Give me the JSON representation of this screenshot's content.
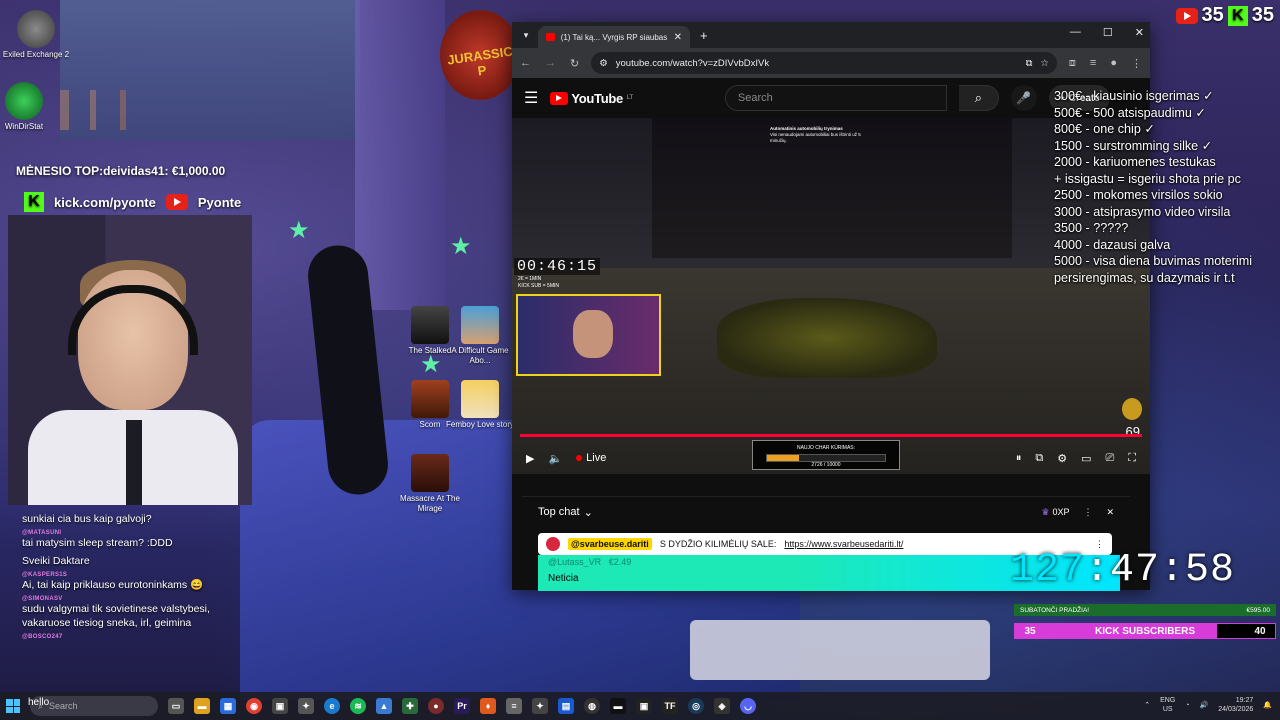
{
  "top_counters": {
    "youtube": "35",
    "kick": "35"
  },
  "overlay": {
    "top_donor": "MĖNESIO TOP:deividas41: €1,000.00",
    "kick_link": "kick.com/pyonte",
    "youtube_name": "Pyonte"
  },
  "desktop_icons": [
    {
      "label": "Exiled Exchange 2"
    },
    {
      "label": "WinDirStat"
    },
    {
      "label": "The Stalked"
    },
    {
      "label": "A Difficult Game Abo..."
    },
    {
      "label": "Scorn"
    },
    {
      "label": "Femboy Love story"
    },
    {
      "label": "Massacre At The Mirage"
    }
  ],
  "poster_text": "JURASSIC P",
  "stream_chat": [
    {
      "user": "",
      "text": "sunkiai cia bus kaip galvoji?"
    },
    {
      "user": "@MATASUNI",
      "text": "tai matysim sleep stream? :DDD"
    },
    {
      "user": "",
      "text": "Sveiki Daktare"
    },
    {
      "user": "@KASPERS1S",
      "text": "Ai, tai kaip priklauso eurotoninkams 😄"
    },
    {
      "user": "@SIMONASV",
      "text": "sudu valgymai tik sovietinese valstybesi, vakaruose tiesiog sneka, irl, geimina"
    },
    {
      "user": "@BOSCO247",
      "text": ""
    }
  ],
  "browser": {
    "tab_title": "(1) Tai ką... Vyrgis RP siaubas. B...",
    "url": "youtube.com/watch?v=zDIVvbDxIVk",
    "youtube": {
      "logo": "YouTube",
      "region": "LT",
      "search_placeholder": "Search",
      "create_label": "Create"
    },
    "video": {
      "timer": "00:46:15",
      "timer_sub": "2€ = 1MIN\nKICK SUB = 5MIN",
      "notification_title": "Automatinis automobilių trynimas",
      "notification_text": "Visi nenaudojami automobiliai bus ištrinti už 5 minučių.",
      "viewer_number": "69",
      "live_label": "Live",
      "goal_title": "NAUJO CHAR KŪRIMAS:",
      "goal_value": "2726 / 10000",
      "goal_progress": 0.27
    },
    "chat": {
      "header": "Top chat",
      "xp": "0XP",
      "pinned_user": "@svarbeuse.dariti",
      "pinned_text": "S DYDŽIO KILIMĖLIŲ SALE:",
      "pinned_link": "https://www.svarbeusedariti.lt/",
      "superchat_user": "@Lutass_VR",
      "superchat_amount": "€2.49",
      "superchat_text": "Neticia"
    }
  },
  "donation_list": [
    "300€ - kiausinio isgerimas ✓",
    "500€ - 500 atsispaudimu ✓",
    "800€ - one chip ✓",
    "1500 - surstromming silke ✓",
    "2000 - kariuomenes testukas",
    "+ issigastu = isgeriu shota prie pc",
    "2500 - mokomes virsilos sokio",
    "3000 - atsiprasymo video virsila",
    "3500 - ?????",
    "4000 - dazausi galva",
    "5000 - visa diena buvimas moterimi",
    "persirengimas, su dazymais ir t.t"
  ],
  "big_clock": {
    "hours": "127",
    "rest": ":47:58"
  },
  "sub_goal": {
    "label": "SUBATONČI PRADŽIA!",
    "value": "€595.00"
  },
  "kick_subs": {
    "left": "35",
    "label": "KICK SUBSCRIBERS",
    "right": "40"
  },
  "taskbar": {
    "search_placeholder": "Search",
    "hello": "hello",
    "lang_top": "ENG",
    "lang_bottom": "US",
    "time": "19:27",
    "date": "24/03/2026"
  }
}
